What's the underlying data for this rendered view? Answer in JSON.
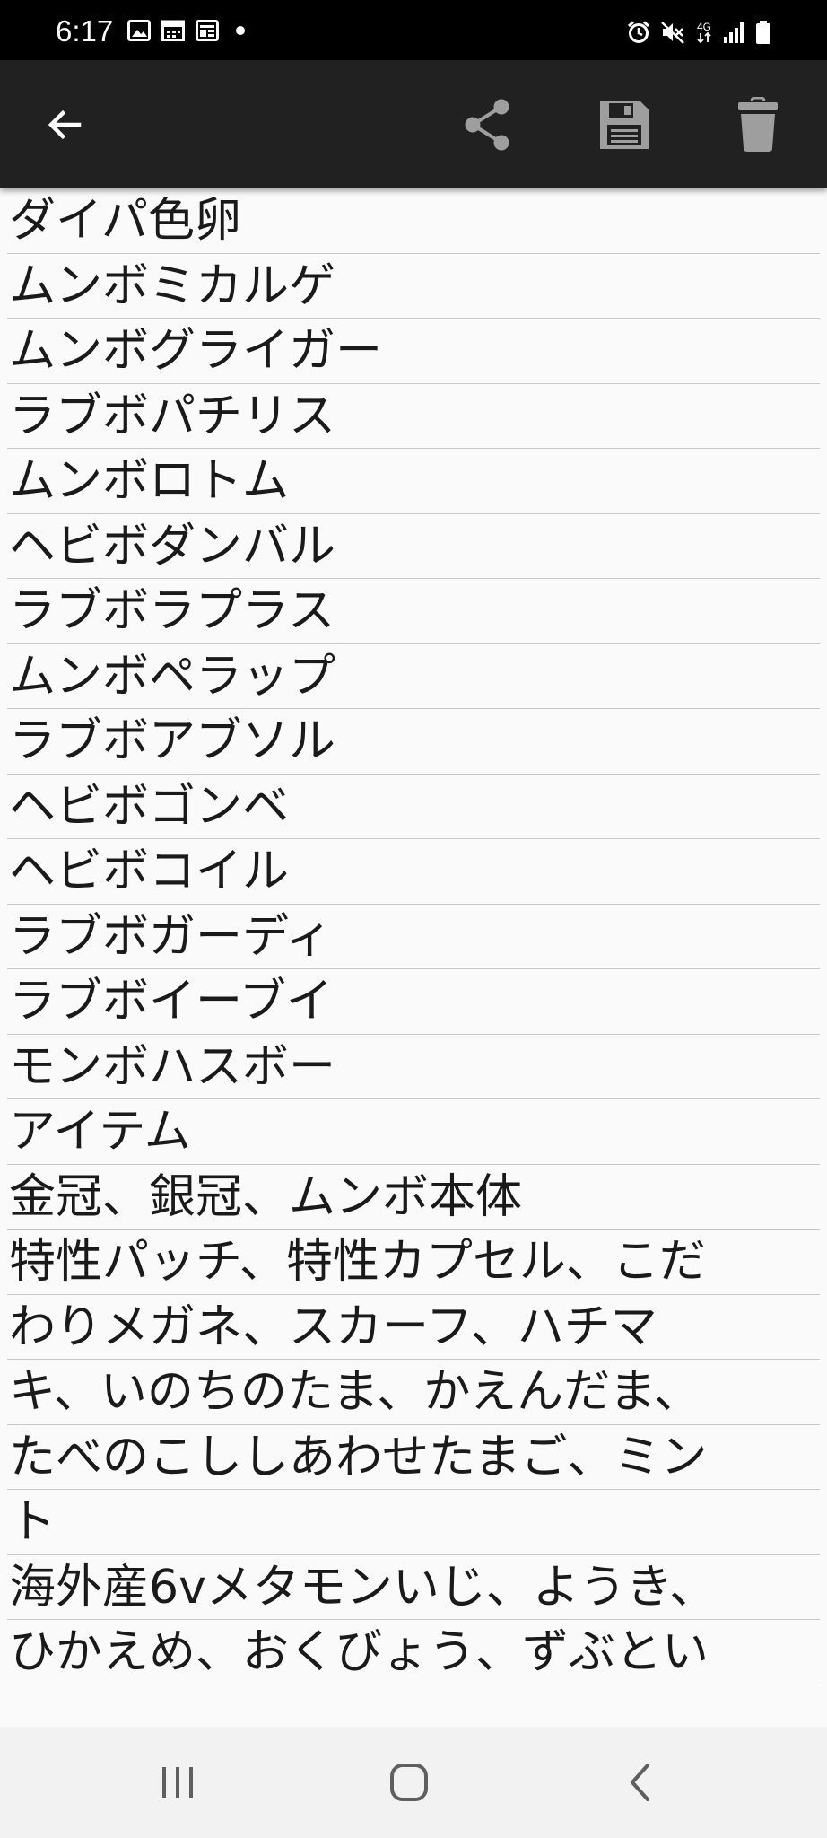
{
  "status_bar": {
    "time": "6:17",
    "network_label": "4G",
    "left_icons": [
      "image-icon",
      "calendar-icon",
      "news-icon",
      "dot-icon"
    ],
    "right_icons": [
      "alarm-icon",
      "mute-icon",
      "network-4g-icon",
      "signal-icon",
      "battery-icon"
    ]
  },
  "toolbar": {
    "back_icon": "arrow-left-icon",
    "share_icon": "share-icon",
    "save_icon": "floppy-disk-icon",
    "delete_icon": "trash-icon",
    "background": "#212121",
    "icon_color_back": "#ffffff",
    "icon_color_actions": "#9e9e9e"
  },
  "note": {
    "lines": [
      "ダイパ色卵",
      "ムンボミカルゲ",
      "ムンボグライガー",
      "ラブボパチリス",
      "ムンボロトム",
      "ヘビボダンバル",
      "ラブボラプラス",
      "ムンボペラップ",
      "ラブボアブソル",
      "ヘビボゴンベ",
      "ヘビボコイル",
      "ラブボガーディ",
      "ラブボイーブイ",
      "モンボハスボー",
      "アイテム",
      "金冠、銀冠、ムンボ本体",
      "特性パッチ、特性カプセル、こだ",
      "わりメガネ、スカーフ、ハチマ",
      "キ、いのちのたま、かえんだま、",
      "たべのこししあわせたまご、ミン",
      "ト",
      "海外産6vメタモンいじ、ようき、",
      "ひかえめ、おくびょう、ずぶとい"
    ]
  },
  "nav_bar": {
    "recent_icon": "recent-apps-icon",
    "home_icon": "home-icon",
    "back_icon": "back-chevron-icon"
  }
}
